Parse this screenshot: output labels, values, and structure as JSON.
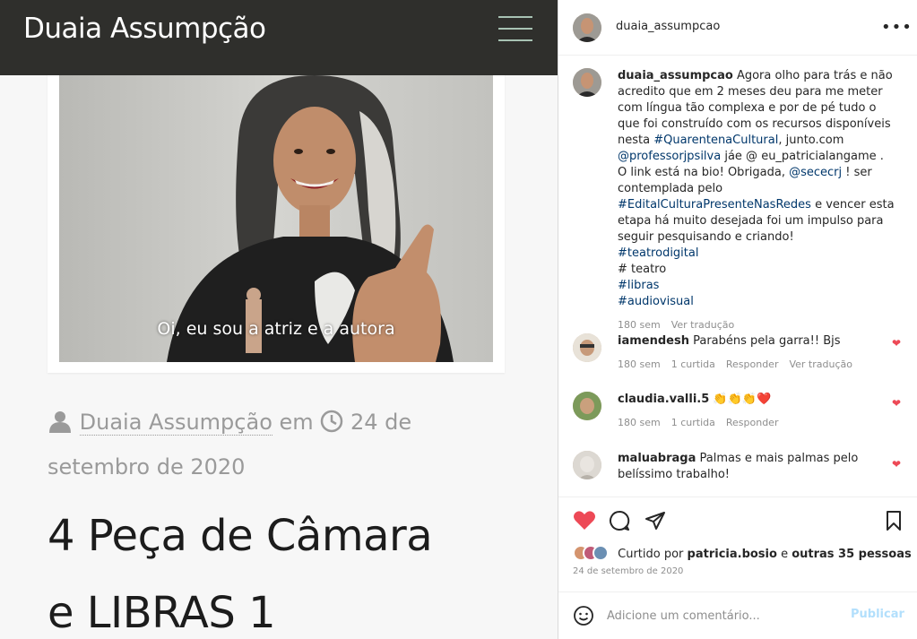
{
  "blog": {
    "site_title": "Duaia Assumpção",
    "video_caption": "Oi, eu sou a atriz e a autora",
    "author": "Duaia Assumpção",
    "by": "em",
    "date_part1": "24 de",
    "date_part2": "setembro de 2020",
    "post_title_line1": "4 Peça de Câmara",
    "post_title_line2": "e LIBRAS 1"
  },
  "instagram": {
    "username": "duaia_assumpcao",
    "caption": {
      "username": "duaia_assumpcao",
      "t1": " Agora olho para trás e não acredito que em 2 meses deu para me meter com língua tão complexa e por de pé tudo o que foi construído com os recursos disponíveis nesta ",
      "tag1": "#QuarentenaCultural",
      "t2": ", junto.com ",
      "tag2": "@professorjpsilva",
      "t3": " jáe @ eu_patricialangame . O link está na bio! Obrigada, ",
      "tag3": "@sececrj",
      "t4": " ! ser contemplada pelo ",
      "tag4": "#EditalCulturaPresenteNasRedes",
      "t5": " e vencer esta etapa há muito desejada foi um impulso para seguir pesquisando e criando!",
      "tag5": "#teatrodigital",
      "t6": "# teatro",
      "tag6": "#libras",
      "tag7": "#audiovisual",
      "time": "180 sem",
      "translate": "Ver tradução"
    },
    "comments": [
      {
        "username": "iamendesh",
        "text": "Parabéns pela garra!! Bjs",
        "time": "180 sem",
        "likes": "1 curtida",
        "reply": "Responder",
        "translate": "Ver tradução"
      },
      {
        "username": "claudia.valli.5",
        "text": "👏👏👏❤️",
        "time": "180 sem",
        "likes": "1 curtida",
        "reply": "Responder"
      },
      {
        "username": "maluabraga",
        "text": "Palmas e mais palmas pelo belíssimo trabalho!"
      }
    ],
    "liked_prefix": "Curtido por ",
    "liked_user": "patricia.bosio",
    "liked_mid": " e ",
    "liked_others": "outras 35 pessoas",
    "post_date": "24 de setembro de 2020",
    "comment_placeholder": "Adicione um comentário...",
    "post_button": "Publicar"
  },
  "colors": {
    "header_bg": "#2f2f2c",
    "menu_accent": "#a7c2b3",
    "like_red": "#ed4956",
    "link_blue": "#00376b",
    "publish_disabled": "#b2dffc"
  },
  "icons": [
    "menu-icon",
    "user-icon",
    "clock-icon",
    "more-icon",
    "heart-icon",
    "comment-icon",
    "share-icon",
    "bookmark-icon",
    "emoji-icon"
  ]
}
